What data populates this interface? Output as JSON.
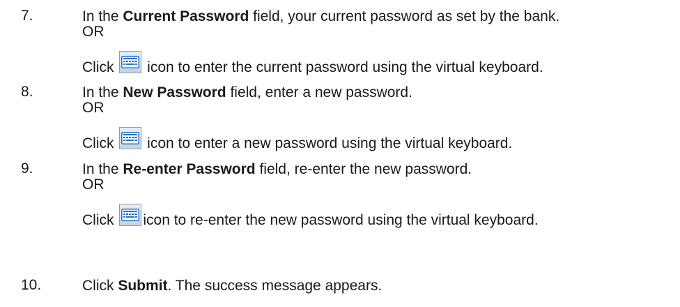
{
  "steps": [
    {
      "number": "7.",
      "pre": "In the ",
      "field": "Current Password",
      "post": " field, your current password as set by the bank.",
      "or": "OR",
      "click_pre": "Click ",
      "click_post": " icon to enter the current password using the virtual keyboard."
    },
    {
      "number": "8.",
      "pre": "In the ",
      "field": "New Password",
      "post": " field, enter a new password.",
      "or": "OR",
      "click_pre": "Click ",
      "click_post": " icon to enter a new password using the virtual keyboard."
    },
    {
      "number": "9.",
      "pre": "In the ",
      "field": "Re-enter Password",
      "post": " field, re-enter the new password.",
      "or": "OR",
      "click_pre": "Click ",
      "click_post": "icon to re-enter the new password using the virtual keyboard."
    },
    {
      "number": "10.",
      "pre": "Click ",
      "field": "Submit",
      "post": ". The success message appears."
    }
  ],
  "icon": "virtual-keyboard-icon",
  "colors": {
    "text": "#1a1a1a",
    "keyboard_blue": "#1e73d2"
  }
}
